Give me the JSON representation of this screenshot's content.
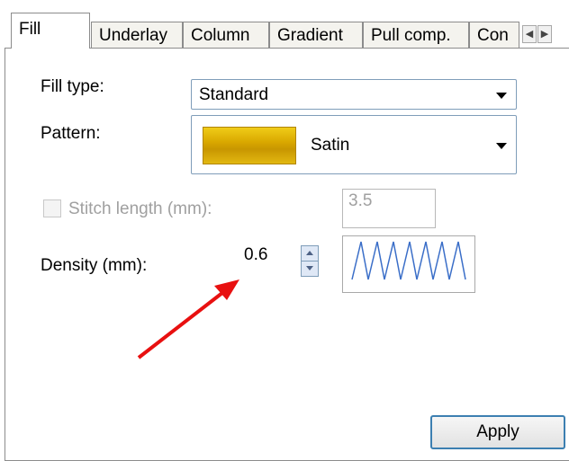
{
  "tabs": [
    {
      "label": "Fill"
    },
    {
      "label": "Underlay"
    },
    {
      "label": "Column"
    },
    {
      "label": "Gradient"
    },
    {
      "label": "Pull comp."
    },
    {
      "label": "Con"
    }
  ],
  "fill_type": {
    "label": "Fill type:",
    "value": "Standard"
  },
  "pattern": {
    "label": "Pattern:",
    "value": "Satin",
    "swatch_color": "#d9a800"
  },
  "stitch_length": {
    "label": "Stitch length (mm):",
    "value": "3.5",
    "checked": false,
    "enabled": false
  },
  "density": {
    "label": "Density (mm):",
    "value": "0.6"
  },
  "actions": {
    "apply_label": "Apply"
  },
  "annotation": {
    "arrow_color": "#e81010"
  }
}
